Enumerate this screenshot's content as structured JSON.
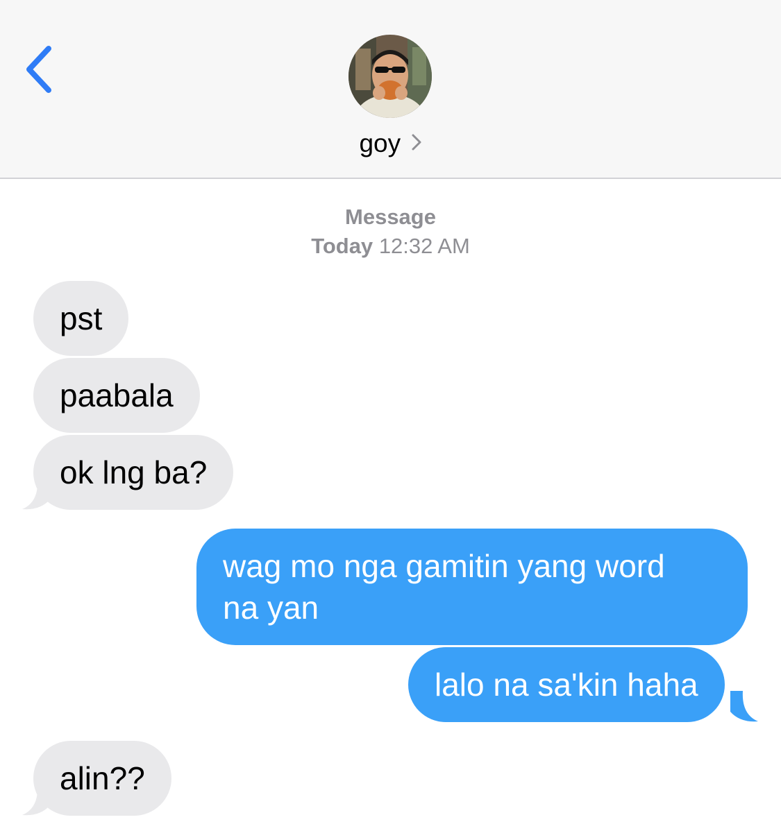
{
  "header": {
    "contact_name": "goy",
    "icons": {
      "back": "chevron-left-icon",
      "contact_details": "chevron-right-icon"
    },
    "accent_color": "#2f7cf6"
  },
  "conversation": {
    "service_label": "Message",
    "timestamp_day": "Today",
    "timestamp_time": "12:32 AM",
    "messages": [
      {
        "direction": "incoming",
        "text": "pst"
      },
      {
        "direction": "incoming",
        "text": "paabala"
      },
      {
        "direction": "incoming",
        "text": "ok lng ba?"
      },
      {
        "direction": "outgoing",
        "lines": [
          "wag mo nga gamitin yang word",
          "na yan"
        ]
      },
      {
        "direction": "outgoing",
        "text": "lalo na sa'kin haha"
      },
      {
        "direction": "incoming",
        "text": "alin??"
      }
    ]
  },
  "colors": {
    "incoming_bubble": "#e9e9eb",
    "outgoing_bubble": "#3aa0f8",
    "header_background": "#f7f7f7",
    "timestamp_text": "#8e8e93"
  }
}
